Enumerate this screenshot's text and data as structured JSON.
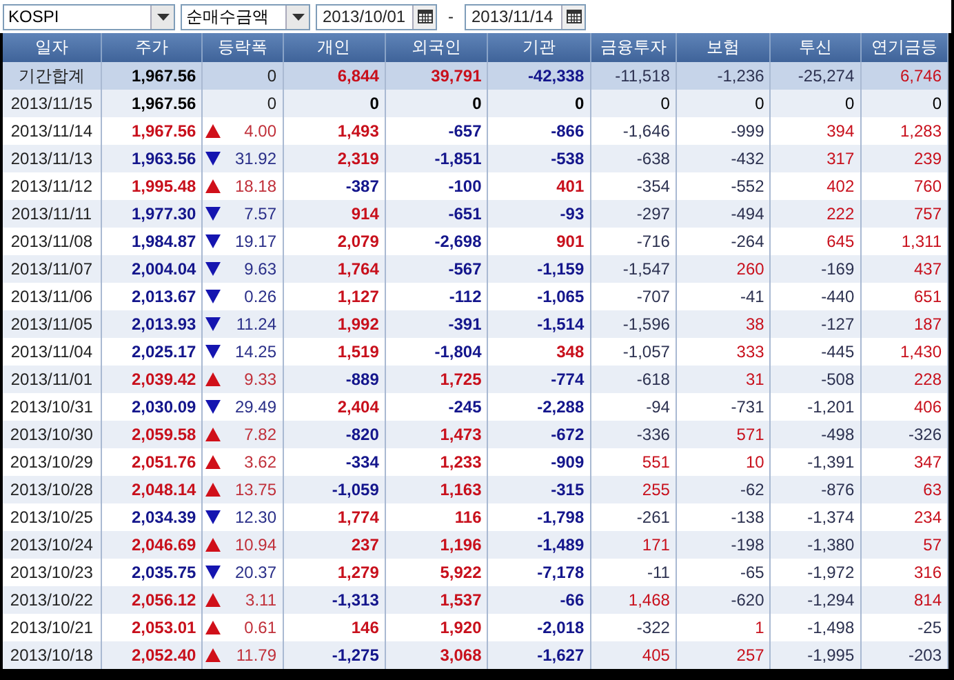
{
  "toolbar": {
    "market": "KOSPI",
    "measure": "순매수금액",
    "start_date": "2013/10/01",
    "separator": "-",
    "end_date": "2013/11/14"
  },
  "table": {
    "columns": [
      "일자",
      "주가",
      "등락폭",
      "개인",
      "외국인",
      "기관",
      "금융투자",
      "보험",
      "투신",
      "연기금등"
    ],
    "rows": [
      {
        "kind": "total",
        "date": "기간합계",
        "price": "1,967.56",
        "change": "0",
        "values": [
          {
            "text": "6,844",
            "color": "#c8101c"
          },
          {
            "text": "39,791",
            "color": "#c8101c"
          },
          {
            "text": "-42,338",
            "color": "#14168c"
          },
          {
            "text": "-11,518",
            "color": "#2c3150"
          },
          {
            "text": "-1,236",
            "color": "#2c3150"
          },
          {
            "text": "-25,274",
            "color": "#2c3150"
          },
          {
            "text": "6,746",
            "color": "#c8101c"
          }
        ]
      },
      {
        "kind": "unchanged",
        "date": "2013/11/15",
        "price": "1,967.56",
        "change": "0",
        "values": [
          {
            "text": "0",
            "color": "#000000"
          },
          {
            "text": "0",
            "color": "#000000"
          },
          {
            "text": "0",
            "color": "#000000"
          },
          {
            "text": "0",
            "color": "#000000"
          },
          {
            "text": "0",
            "color": "#000000"
          },
          {
            "text": "0",
            "color": "#000000"
          },
          {
            "text": "0",
            "color": "#000000"
          }
        ]
      },
      {
        "kind": "rise",
        "date": "2013/11/14",
        "price": "1,967.56",
        "change": "4.00",
        "values": [
          {
            "text": "1,493",
            "color": "#c8101c"
          },
          {
            "text": "-657",
            "color": "#14168c"
          },
          {
            "text": "-866",
            "color": "#14168c"
          },
          {
            "text": "-1,646",
            "color": "#2c3150"
          },
          {
            "text": "-999",
            "color": "#2c3150"
          },
          {
            "text": "394",
            "color": "#c8101c"
          },
          {
            "text": "1,283",
            "color": "#c8101c"
          }
        ]
      },
      {
        "kind": "fall",
        "date": "2013/11/13",
        "price": "1,963.56",
        "change": "31.92",
        "values": [
          {
            "text": "2,319",
            "color": "#c8101c"
          },
          {
            "text": "-1,851",
            "color": "#14168c"
          },
          {
            "text": "-538",
            "color": "#14168c"
          },
          {
            "text": "-638",
            "color": "#2c3150"
          },
          {
            "text": "-432",
            "color": "#2c3150"
          },
          {
            "text": "317",
            "color": "#c8101c"
          },
          {
            "text": "239",
            "color": "#c8101c"
          }
        ]
      },
      {
        "kind": "rise",
        "date": "2013/11/12",
        "price": "1,995.48",
        "change": "18.18",
        "values": [
          {
            "text": "-387",
            "color": "#14168c"
          },
          {
            "text": "-100",
            "color": "#14168c"
          },
          {
            "text": "401",
            "color": "#c8101c"
          },
          {
            "text": "-354",
            "color": "#2c3150"
          },
          {
            "text": "-552",
            "color": "#2c3150"
          },
          {
            "text": "402",
            "color": "#c8101c"
          },
          {
            "text": "760",
            "color": "#c8101c"
          }
        ]
      },
      {
        "kind": "fall",
        "date": "2013/11/11",
        "price": "1,977.30",
        "change": "7.57",
        "values": [
          {
            "text": "914",
            "color": "#c8101c"
          },
          {
            "text": "-651",
            "color": "#14168c"
          },
          {
            "text": "-93",
            "color": "#14168c"
          },
          {
            "text": "-297",
            "color": "#2c3150"
          },
          {
            "text": "-494",
            "color": "#2c3150"
          },
          {
            "text": "222",
            "color": "#c8101c"
          },
          {
            "text": "757",
            "color": "#c8101c"
          }
        ]
      },
      {
        "kind": "fall",
        "date": "2013/11/08",
        "price": "1,984.87",
        "change": "19.17",
        "values": [
          {
            "text": "2,079",
            "color": "#c8101c"
          },
          {
            "text": "-2,698",
            "color": "#14168c"
          },
          {
            "text": "901",
            "color": "#c8101c"
          },
          {
            "text": "-716",
            "color": "#2c3150"
          },
          {
            "text": "-264",
            "color": "#2c3150"
          },
          {
            "text": "645",
            "color": "#c8101c"
          },
          {
            "text": "1,311",
            "color": "#c8101c"
          }
        ]
      },
      {
        "kind": "fall",
        "date": "2013/11/07",
        "price": "2,004.04",
        "change": "9.63",
        "values": [
          {
            "text": "1,764",
            "color": "#c8101c"
          },
          {
            "text": "-567",
            "color": "#14168c"
          },
          {
            "text": "-1,159",
            "color": "#14168c"
          },
          {
            "text": "-1,547",
            "color": "#2c3150"
          },
          {
            "text": "260",
            "color": "#c8101c"
          },
          {
            "text": "-169",
            "color": "#2c3150"
          },
          {
            "text": "437",
            "color": "#c8101c"
          }
        ]
      },
      {
        "kind": "fall",
        "date": "2013/11/06",
        "price": "2,013.67",
        "change": "0.26",
        "values": [
          {
            "text": "1,127",
            "color": "#c8101c"
          },
          {
            "text": "-112",
            "color": "#14168c"
          },
          {
            "text": "-1,065",
            "color": "#14168c"
          },
          {
            "text": "-707",
            "color": "#2c3150"
          },
          {
            "text": "-41",
            "color": "#2c3150"
          },
          {
            "text": "-440",
            "color": "#2c3150"
          },
          {
            "text": "651",
            "color": "#c8101c"
          }
        ]
      },
      {
        "kind": "fall",
        "date": "2013/11/05",
        "price": "2,013.93",
        "change": "11.24",
        "values": [
          {
            "text": "1,992",
            "color": "#c8101c"
          },
          {
            "text": "-391",
            "color": "#14168c"
          },
          {
            "text": "-1,514",
            "color": "#14168c"
          },
          {
            "text": "-1,596",
            "color": "#2c3150"
          },
          {
            "text": "38",
            "color": "#c8101c"
          },
          {
            "text": "-127",
            "color": "#2c3150"
          },
          {
            "text": "187",
            "color": "#c8101c"
          }
        ]
      },
      {
        "kind": "fall",
        "date": "2013/11/04",
        "price": "2,025.17",
        "change": "14.25",
        "values": [
          {
            "text": "1,519",
            "color": "#c8101c"
          },
          {
            "text": "-1,804",
            "color": "#14168c"
          },
          {
            "text": "348",
            "color": "#c8101c"
          },
          {
            "text": "-1,057",
            "color": "#2c3150"
          },
          {
            "text": "333",
            "color": "#c8101c"
          },
          {
            "text": "-445",
            "color": "#2c3150"
          },
          {
            "text": "1,430",
            "color": "#c8101c"
          }
        ]
      },
      {
        "kind": "rise",
        "date": "2013/11/01",
        "price": "2,039.42",
        "change": "9.33",
        "values": [
          {
            "text": "-889",
            "color": "#14168c"
          },
          {
            "text": "1,725",
            "color": "#c8101c"
          },
          {
            "text": "-774",
            "color": "#14168c"
          },
          {
            "text": "-618",
            "color": "#2c3150"
          },
          {
            "text": "31",
            "color": "#c8101c"
          },
          {
            "text": "-508",
            "color": "#2c3150"
          },
          {
            "text": "228",
            "color": "#c8101c"
          }
        ]
      },
      {
        "kind": "fall",
        "date": "2013/10/31",
        "price": "2,030.09",
        "change": "29.49",
        "values": [
          {
            "text": "2,404",
            "color": "#c8101c"
          },
          {
            "text": "-245",
            "color": "#14168c"
          },
          {
            "text": "-2,288",
            "color": "#14168c"
          },
          {
            "text": "-94",
            "color": "#2c3150"
          },
          {
            "text": "-731",
            "color": "#2c3150"
          },
          {
            "text": "-1,201",
            "color": "#2c3150"
          },
          {
            "text": "406",
            "color": "#c8101c"
          }
        ]
      },
      {
        "kind": "rise",
        "date": "2013/10/30",
        "price": "2,059.58",
        "change": "7.82",
        "values": [
          {
            "text": "-820",
            "color": "#14168c"
          },
          {
            "text": "1,473",
            "color": "#c8101c"
          },
          {
            "text": "-672",
            "color": "#14168c"
          },
          {
            "text": "-336",
            "color": "#2c3150"
          },
          {
            "text": "571",
            "color": "#c8101c"
          },
          {
            "text": "-498",
            "color": "#2c3150"
          },
          {
            "text": "-326",
            "color": "#2c3150"
          }
        ]
      },
      {
        "kind": "rise",
        "date": "2013/10/29",
        "price": "2,051.76",
        "change": "3.62",
        "values": [
          {
            "text": "-334",
            "color": "#14168c"
          },
          {
            "text": "1,233",
            "color": "#c8101c"
          },
          {
            "text": "-909",
            "color": "#14168c"
          },
          {
            "text": "551",
            "color": "#c8101c"
          },
          {
            "text": "10",
            "color": "#c8101c"
          },
          {
            "text": "-1,391",
            "color": "#2c3150"
          },
          {
            "text": "347",
            "color": "#c8101c"
          }
        ]
      },
      {
        "kind": "rise",
        "date": "2013/10/28",
        "price": "2,048.14",
        "change": "13.75",
        "values": [
          {
            "text": "-1,059",
            "color": "#14168c"
          },
          {
            "text": "1,163",
            "color": "#c8101c"
          },
          {
            "text": "-315",
            "color": "#14168c"
          },
          {
            "text": "255",
            "color": "#c8101c"
          },
          {
            "text": "-62",
            "color": "#2c3150"
          },
          {
            "text": "-876",
            "color": "#2c3150"
          },
          {
            "text": "63",
            "color": "#c8101c"
          }
        ]
      },
      {
        "kind": "fall",
        "date": "2013/10/25",
        "price": "2,034.39",
        "change": "12.30",
        "values": [
          {
            "text": "1,774",
            "color": "#c8101c"
          },
          {
            "text": "116",
            "color": "#c8101c"
          },
          {
            "text": "-1,798",
            "color": "#14168c"
          },
          {
            "text": "-261",
            "color": "#2c3150"
          },
          {
            "text": "-138",
            "color": "#2c3150"
          },
          {
            "text": "-1,374",
            "color": "#2c3150"
          },
          {
            "text": "234",
            "color": "#c8101c"
          }
        ]
      },
      {
        "kind": "rise",
        "date": "2013/10/24",
        "price": "2,046.69",
        "change": "10.94",
        "values": [
          {
            "text": "237",
            "color": "#c8101c"
          },
          {
            "text": "1,196",
            "color": "#c8101c"
          },
          {
            "text": "-1,489",
            "color": "#14168c"
          },
          {
            "text": "171",
            "color": "#c8101c"
          },
          {
            "text": "-198",
            "color": "#2c3150"
          },
          {
            "text": "-1,380",
            "color": "#2c3150"
          },
          {
            "text": "57",
            "color": "#c8101c"
          }
        ]
      },
      {
        "kind": "fall",
        "date": "2013/10/23",
        "price": "2,035.75",
        "change": "20.37",
        "values": [
          {
            "text": "1,279",
            "color": "#c8101c"
          },
          {
            "text": "5,922",
            "color": "#c8101c"
          },
          {
            "text": "-7,178",
            "color": "#14168c"
          },
          {
            "text": "-11",
            "color": "#2c3150"
          },
          {
            "text": "-65",
            "color": "#2c3150"
          },
          {
            "text": "-1,972",
            "color": "#2c3150"
          },
          {
            "text": "316",
            "color": "#c8101c"
          }
        ]
      },
      {
        "kind": "rise",
        "date": "2013/10/22",
        "price": "2,056.12",
        "change": "3.11",
        "values": [
          {
            "text": "-1,313",
            "color": "#14168c"
          },
          {
            "text": "1,537",
            "color": "#c8101c"
          },
          {
            "text": "-66",
            "color": "#14168c"
          },
          {
            "text": "1,468",
            "color": "#c8101c"
          },
          {
            "text": "-620",
            "color": "#2c3150"
          },
          {
            "text": "-1,294",
            "color": "#2c3150"
          },
          {
            "text": "814",
            "color": "#c8101c"
          }
        ]
      },
      {
        "kind": "rise",
        "date": "2013/10/21",
        "price": "2,053.01",
        "change": "0.61",
        "values": [
          {
            "text": "146",
            "color": "#c8101c"
          },
          {
            "text": "1,920",
            "color": "#c8101c"
          },
          {
            "text": "-2,018",
            "color": "#14168c"
          },
          {
            "text": "-322",
            "color": "#2c3150"
          },
          {
            "text": "1",
            "color": "#c8101c"
          },
          {
            "text": "-1,498",
            "color": "#2c3150"
          },
          {
            "text": "-25",
            "color": "#2c3150"
          }
        ]
      },
      {
        "kind": "rise",
        "date": "2013/10/18",
        "price": "2,052.40",
        "change": "11.79",
        "values": [
          {
            "text": "-1,275",
            "color": "#14168c"
          },
          {
            "text": "3,068",
            "color": "#c8101c"
          },
          {
            "text": "-1,627",
            "color": "#14168c"
          },
          {
            "text": "405",
            "color": "#c8101c"
          },
          {
            "text": "257",
            "color": "#c8101c"
          },
          {
            "text": "-1,995",
            "color": "#2c3150"
          },
          {
            "text": "-203",
            "color": "#2c3150"
          }
        ]
      }
    ]
  }
}
